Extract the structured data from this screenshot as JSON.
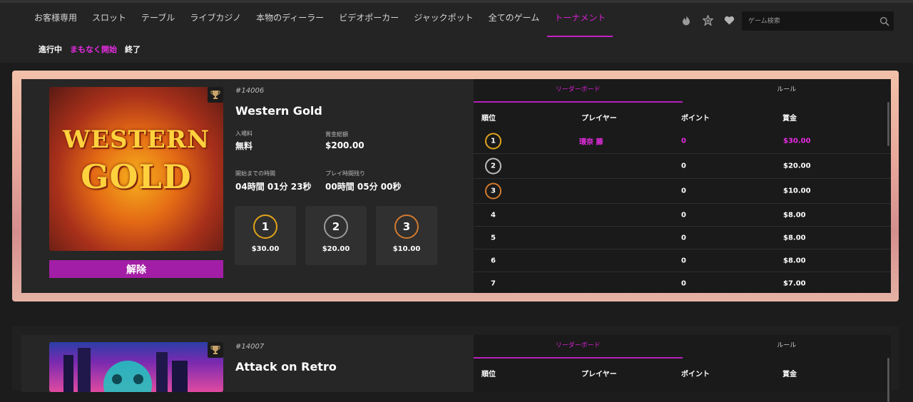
{
  "nav": {
    "items": [
      {
        "label": "お客様専用"
      },
      {
        "label": "スロット"
      },
      {
        "label": "テーブル"
      },
      {
        "label": "ライブカジノ"
      },
      {
        "label": "本物のディーラー"
      },
      {
        "label": "ビデオポーカー"
      },
      {
        "label": "ジャックポット"
      },
      {
        "label": "全てのゲーム"
      },
      {
        "label": "トーナメント"
      }
    ],
    "active": "トーナメント"
  },
  "subnav": {
    "items": [
      {
        "label": "進行中"
      },
      {
        "label": "まもなく開始"
      },
      {
        "label": "終了"
      }
    ],
    "active": "まもなく開始"
  },
  "header_icons": [
    "fire-icon",
    "star-badge-icon",
    "heart-icon"
  ],
  "search": {
    "placeholder": "ゲーム検索",
    "icon": "search-icon"
  },
  "tournaments": [
    {
      "id": "#14006",
      "name": "Western Gold",
      "image_text": [
        "WESTERN",
        "GOLD"
      ],
      "entry_fee_label": "入場料",
      "entry_fee": "無料",
      "prize_pool_label": "賞金総額",
      "prize_pool": "$200.00",
      "time_to_start_label": "開始までの時間",
      "time_to_start": "04時間 01分 23秒",
      "play_time_left_label": "プレイ時間残り",
      "play_time_left": "00時間 05分 00秒",
      "prizes": [
        {
          "rank": "1",
          "amount": "$30.00",
          "color": "#e0a41a"
        },
        {
          "rank": "2",
          "amount": "$20.00",
          "color": "#9a9a9a"
        },
        {
          "rank": "3",
          "amount": "$10.00",
          "color": "#d27a2e"
        }
      ],
      "unregister_label": "解除",
      "tabs": {
        "leaderboard": "リーダーボード",
        "rules": "ルール"
      },
      "columns": {
        "rank": "順位",
        "player": "プレイヤー",
        "points": "ポイント",
        "prize": "賞金"
      },
      "rows": [
        {
          "rank": "1",
          "player": "環奈 藤",
          "points": "0",
          "prize": "$30.00",
          "highlight": true
        },
        {
          "rank": "2",
          "player": "",
          "points": "0",
          "prize": "$20.00",
          "highlight": false
        },
        {
          "rank": "3",
          "player": "",
          "points": "0",
          "prize": "$10.00",
          "highlight": false
        },
        {
          "rank": "4",
          "player": "",
          "points": "0",
          "prize": "$8.00",
          "highlight": false
        },
        {
          "rank": "5",
          "player": "",
          "points": "0",
          "prize": "$8.00",
          "highlight": false
        },
        {
          "rank": "6",
          "player": "",
          "points": "0",
          "prize": "$8.00",
          "highlight": false
        },
        {
          "rank": "7",
          "player": "",
          "points": "0",
          "prize": "$7.00",
          "highlight": false
        }
      ]
    },
    {
      "id": "#14007",
      "name": "Attack on Retro",
      "tabs": {
        "leaderboard": "リーダーボード",
        "rules": "ルール"
      },
      "columns": {
        "rank": "順位",
        "player": "プレイヤー",
        "points": "ポイント",
        "prize": "賞金"
      }
    }
  ],
  "colors": {
    "accent": "#c41ec7",
    "highlight_text": "#e52ce0",
    "button": "#a31ea6",
    "gold": "#e0a41a",
    "silver": "#9a9a9a",
    "bronze": "#d27a2e"
  }
}
